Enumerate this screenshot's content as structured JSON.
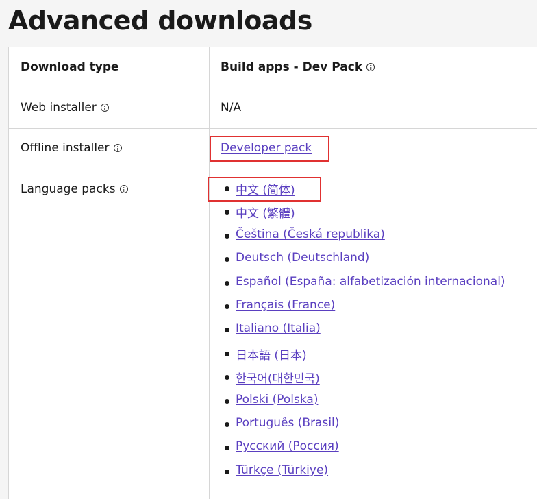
{
  "page": {
    "title": "Advanced downloads"
  },
  "table": {
    "header": {
      "col1": "Download type",
      "col2": "Build apps - Dev Pack"
    },
    "rows": {
      "web_installer": {
        "label": "Web installer",
        "value": "N/A"
      },
      "offline_installer": {
        "label": "Offline installer",
        "link": "Developer pack"
      },
      "language_packs": {
        "label": "Language packs",
        "links": [
          "中文 (简体)",
          "中文 (繁體)",
          "Čeština (Česká republika)",
          "Deutsch (Deutschland)",
          "Español (España: alfabetización internacional)",
          "Français (France)",
          "Italiano (Italia)",
          "日本語 (日本)",
          "한국어(대한민국)",
          "Polski (Polska)",
          "Português (Brasil)",
          "Русский (Россия)",
          "Türkçe (Türkiye)"
        ]
      }
    }
  },
  "icons": {
    "info": "info-circle-icon"
  },
  "colors": {
    "link": "#5a3fc0",
    "highlight": "#e03131",
    "border": "#d6d6d6",
    "background": "#f5f5f5"
  }
}
